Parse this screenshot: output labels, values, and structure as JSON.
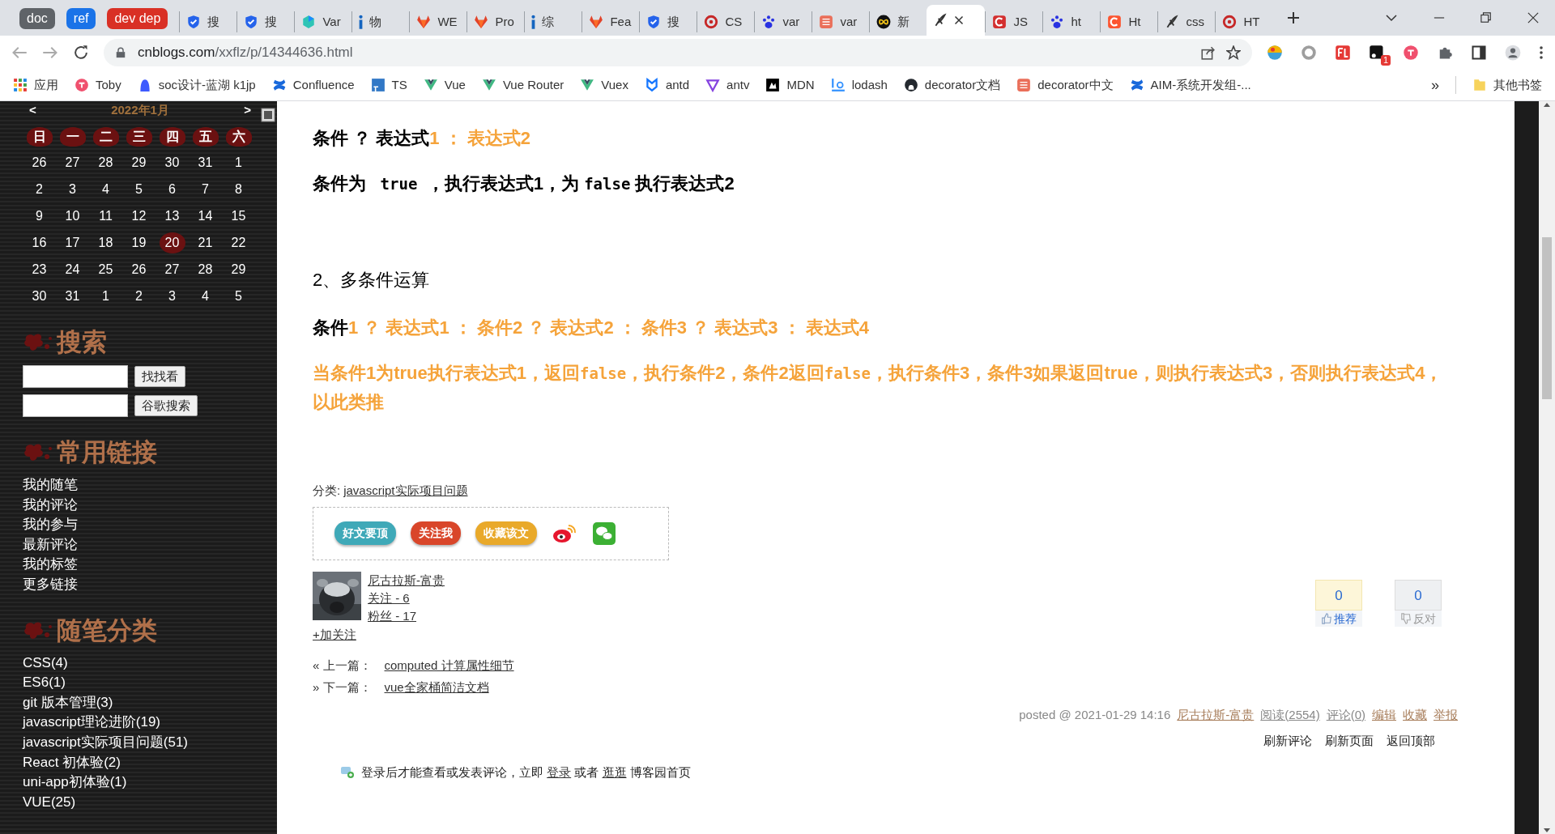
{
  "browser": {
    "tabs": [
      {
        "kind": "group",
        "label": "doc",
        "color": "#5f6368"
      },
      {
        "kind": "group",
        "label": "ref",
        "color": "#1a73e8"
      },
      {
        "kind": "group",
        "label": "dev dep",
        "color": "#d93025"
      },
      {
        "kind": "tab",
        "label": "搜",
        "selected": false
      },
      {
        "kind": "tab",
        "label": "搜",
        "selected": false
      },
      {
        "kind": "tab",
        "label": "Var",
        "selected": false
      },
      {
        "kind": "tab",
        "label": "物",
        "selected": false
      },
      {
        "kind": "tab",
        "label": "WE",
        "selected": false
      },
      {
        "kind": "tab",
        "label": "Pro",
        "selected": false
      },
      {
        "kind": "tab",
        "label": "综",
        "selected": false
      },
      {
        "kind": "tab",
        "label": "Fea",
        "selected": false
      },
      {
        "kind": "tab",
        "label": "搜",
        "selected": false
      },
      {
        "kind": "tab",
        "label": "CS",
        "selected": false
      },
      {
        "kind": "tab",
        "label": "var",
        "selected": false
      },
      {
        "kind": "tab",
        "label": "var",
        "selected": false
      },
      {
        "kind": "tab",
        "label": "新",
        "selected": false
      },
      {
        "kind": "tab",
        "selected": true
      },
      {
        "kind": "tab",
        "label": "JS",
        "selected": false
      },
      {
        "kind": "tab",
        "label": "ht",
        "selected": false
      },
      {
        "kind": "tab",
        "label": "Ht",
        "selected": false
      },
      {
        "kind": "tab",
        "label": "css",
        "selected": false
      },
      {
        "kind": "tab",
        "label": "HT",
        "selected": false
      }
    ],
    "address": {
      "host": "cnblogs.com",
      "path": "/xxflz/p/14344636.html"
    },
    "extension_badge": "1",
    "bookmarks": [
      "应用",
      "Toby",
      "soc设计-蓝湖 k1jp",
      "Confluence",
      "TS",
      "Vue",
      "Vue Router",
      "Vuex",
      "antd",
      "antv",
      "MDN",
      "lodash",
      "decorator文档",
      "decorator中文",
      "AIM-系统开发组-..."
    ],
    "more": "»",
    "other": "其他书签"
  },
  "sidebar": {
    "calendar": {
      "prev": "<",
      "month": "2022年1月",
      "next": ">",
      "weekdays": [
        "日",
        "一",
        "二",
        "三",
        "四",
        "五",
        "六"
      ],
      "weeks": [
        [
          {
            "day": "26",
            "selected": false
          },
          {
            "day": "27",
            "selected": false
          },
          {
            "day": "28",
            "selected": false
          },
          {
            "day": "29",
            "selected": false
          },
          {
            "day": "30",
            "selected": false
          },
          {
            "day": "31",
            "selected": false
          },
          {
            "day": "1",
            "selected": false
          }
        ],
        [
          {
            "day": "2",
            "selected": false
          },
          {
            "day": "3",
            "selected": false
          },
          {
            "day": "4",
            "selected": false
          },
          {
            "day": "5",
            "selected": false
          },
          {
            "day": "6",
            "selected": false
          },
          {
            "day": "7",
            "selected": false
          },
          {
            "day": "8",
            "selected": false
          }
        ],
        [
          {
            "day": "9",
            "selected": false
          },
          {
            "day": "10",
            "selected": false
          },
          {
            "day": "11",
            "selected": false
          },
          {
            "day": "12",
            "selected": false
          },
          {
            "day": "13",
            "selected": false
          },
          {
            "day": "14",
            "selected": false
          },
          {
            "day": "15",
            "selected": false
          }
        ],
        [
          {
            "day": "16",
            "selected": false
          },
          {
            "day": "17",
            "selected": false
          },
          {
            "day": "18",
            "selected": false
          },
          {
            "day": "19",
            "selected": false
          },
          {
            "day": "20",
            "selected": true
          },
          {
            "day": "21",
            "selected": false
          },
          {
            "day": "22",
            "selected": false
          }
        ],
        [
          {
            "day": "23",
            "selected": false
          },
          {
            "day": "24",
            "selected": false
          },
          {
            "day": "25",
            "selected": false
          },
          {
            "day": "26",
            "selected": false
          },
          {
            "day": "27",
            "selected": false
          },
          {
            "day": "28",
            "selected": false
          },
          {
            "day": "29",
            "selected": false
          }
        ],
        [
          {
            "day": "30",
            "selected": false
          },
          {
            "day": "31",
            "selected": false
          },
          {
            "day": "1",
            "selected": false
          },
          {
            "day": "2",
            "selected": false
          },
          {
            "day": "3",
            "selected": false
          },
          {
            "day": "4",
            "selected": false
          },
          {
            "day": "5",
            "selected": false
          }
        ]
      ]
    },
    "search": {
      "title": "搜索",
      "buttons": [
        "找找看",
        "谷歌搜索"
      ]
    },
    "links": {
      "title": "常用链接",
      "items": [
        "我的随笔",
        "我的评论",
        "我的参与",
        "最新评论",
        "我的标签",
        "更多链接"
      ]
    },
    "categories": {
      "title": "随笔分类",
      "items": [
        "CSS(4)",
        "ES6(1)",
        "git 版本管理(3)",
        "javascript理论进阶(19)",
        "javascript实际项目问题(51)",
        "React 初体验(2)",
        "uni-app初体验(1)",
        "VUE(25)"
      ]
    }
  },
  "article": {
    "paragraphs": [
      {
        "kind": "formula",
        "segments": [
          {
            "text": "条件 ？ 表达式",
            "highlight": false,
            "code": false
          },
          {
            "text": "1 ： 表达式2",
            "highlight": true,
            "code": false
          }
        ]
      },
      {
        "kind": "formula",
        "segments": [
          {
            "text": "条件为 ",
            "highlight": false,
            "code": false
          },
          {
            "text": " true ",
            "highlight": false,
            "code": true
          },
          {
            "text": "，执行表达式1，为 ",
            "highlight": false,
            "code": false
          },
          {
            "text": "false",
            "highlight": false,
            "code": true
          },
          {
            "text": " 执行表达式2",
            "highlight": false,
            "code": false
          }
        ]
      },
      {
        "kind": "heading",
        "text": "2、多条件运算"
      },
      {
        "kind": "formula",
        "segments": [
          {
            "text": "条件",
            "highlight": false,
            "code": false
          },
          {
            "text": "1 ？ 表达式1 ： 条件2 ？ 表达式2 ： 条件3 ？ 表达式3 ： 表达式4",
            "highlight": true,
            "code": false
          }
        ]
      },
      {
        "kind": "formula",
        "segments": [
          {
            "text": "当条件1为true执行表达式1，返回",
            "highlight": true,
            "code": false
          },
          {
            "text": "false",
            "highlight": true,
            "code": true
          },
          {
            "text": "，执行条件2，条件2返回",
            "highlight": true,
            "code": false
          },
          {
            "text": "false",
            "highlight": true,
            "code": true
          },
          {
            "text": "，执行条件3，条件3如果返回true，则执行表达式3，否则执行表达式4，以此类推",
            "highlight": true,
            "code": false
          }
        ]
      }
    ],
    "category": {
      "label": "分类:",
      "link": "javascript实际项目问题"
    },
    "share": [
      {
        "label": "好文要顶",
        "color": "#3fa9b8"
      },
      {
        "label": "关注我",
        "color": "#d9462a"
      },
      {
        "label": "收藏该文",
        "color": "#e9a92a"
      }
    ],
    "author": {
      "name": "尼古拉斯-富贵",
      "follow": "关注 - 6",
      "fans": "粉丝 - 17",
      "add": "+加关注"
    },
    "votes": [
      {
        "kind": "up",
        "count": "0",
        "label": "推荐"
      },
      {
        "kind": "down",
        "count": "0",
        "label": "反对"
      }
    ],
    "nav": [
      {
        "prefix": "« 上一篇：",
        "link": "computed 计算属性细节"
      },
      {
        "prefix": "» 下一篇：",
        "link": "vue全家桶简洁文档"
      }
    ],
    "posted": {
      "text": "posted @ 2021-01-29 14:16",
      "links": [
        "尼古拉斯-富贵",
        "阅读(2554)",
        "评论(0)",
        "编辑",
        "收藏",
        "举报"
      ]
    },
    "actions": [
      "刷新评论",
      "刷新页面",
      "返回顶部"
    ],
    "login": {
      "before": "登录后才能查看或发表评论，立即 ",
      "link1": "登录",
      "middle": " 或者 ",
      "link2": "逛逛",
      "after": " 博客园首页"
    }
  }
}
